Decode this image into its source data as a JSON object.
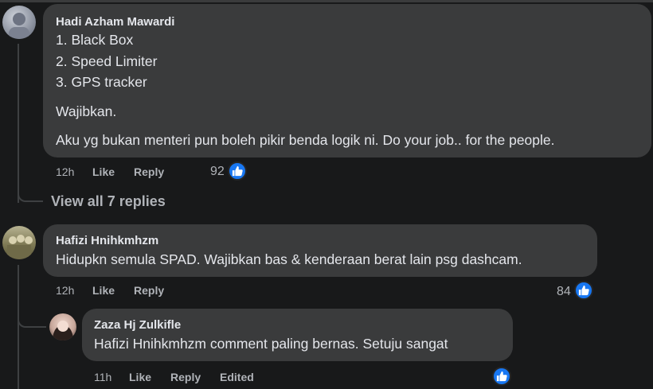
{
  "comments": [
    {
      "author": "Hadi Azham Mawardi",
      "lines": [
        "1. Black Box",
        "2. Speed Limiter",
        "3. GPS tracker"
      ],
      "para1": "Wajibkan.",
      "para2": "Aku yg bukan menteri pun boleh pikir benda logik ni. Do your job.. for the people.",
      "time": "12h",
      "like": "Like",
      "reply": "Reply",
      "reactions": "92"
    },
    {
      "author": "Hafizi Hnihkmhzm",
      "text": "Hidupkn semula SPAD. Wajibkan bas & kenderaan berat lain psg dashcam.",
      "time": "12h",
      "like": "Like",
      "reply": "Reply",
      "reactions": "84"
    }
  ],
  "view_replies": "View all 7 replies",
  "reply": {
    "author": "Zaza Hj Zulkifle",
    "text": "Hafizi Hnihkmhzm comment paling bernas. Setuju sangat",
    "time": "11h",
    "like": "Like",
    "reply": "Reply",
    "edited": "Edited"
  },
  "colors": {
    "background": "#18191a",
    "bubble": "#3a3b3c",
    "like_blue": "#1877f2"
  }
}
